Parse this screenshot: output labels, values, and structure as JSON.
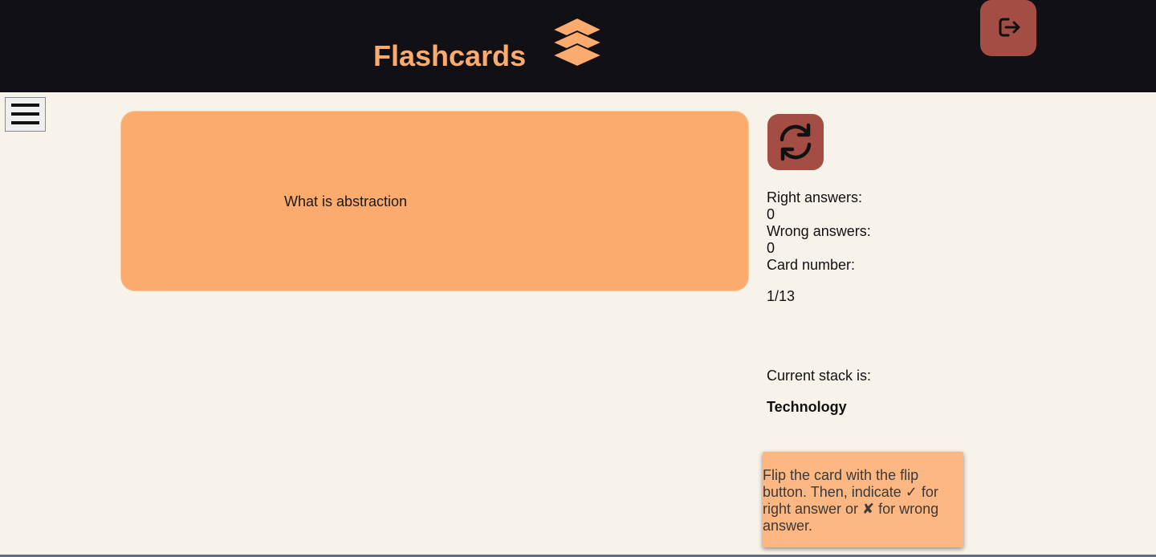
{
  "header": {
    "title": "Flashcards",
    "logo_icon": "layers-stack-icon",
    "logout_icon": "logout-icon"
  },
  "menu": {
    "icon": "hamburger-menu-icon"
  },
  "card": {
    "text": "What is abstraction"
  },
  "flip": {
    "icon": "flip-refresh-icon"
  },
  "stats": {
    "right_label": "Right answers:",
    "right_value": "0",
    "wrong_label": "Wrong answers:",
    "wrong_value": "0",
    "card_number_label": "Card number:",
    "card_number_value": "1/13"
  },
  "stack": {
    "label": "Current stack is:",
    "name": "Technology"
  },
  "help": {
    "text": "Flip the card with the flip button. Then, indicate ✓ for right answer or ✘ for wrong answer."
  },
  "colors": {
    "header_bg": "#111115",
    "accent": "#fbab6e",
    "button": "#a34d44",
    "page_bg": "#f8f3ea"
  }
}
